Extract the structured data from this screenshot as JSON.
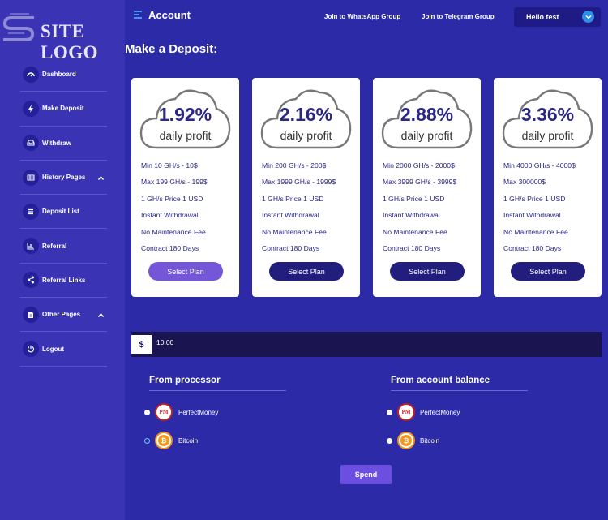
{
  "sidebar": {
    "logo_text": "SITE LOGO",
    "items": [
      {
        "label": "Dashboard",
        "icon": "gauge-icon"
      },
      {
        "label": "Make Deposit",
        "icon": "bolt-icon"
      },
      {
        "label": "Withdraw",
        "icon": "tray-icon"
      },
      {
        "label": "History Pages",
        "icon": "table-icon",
        "caret": "^"
      },
      {
        "label": "Deposit List",
        "icon": "list-icon"
      },
      {
        "label": "Referral",
        "icon": "bar-chart-icon"
      },
      {
        "label": "Referral Links",
        "icon": "share-icon"
      },
      {
        "label": "Other Pages",
        "icon": "file-icon",
        "caret": "^"
      },
      {
        "label": "Logout",
        "icon": "power-icon"
      }
    ]
  },
  "header": {
    "title": "Account",
    "whatsapp_link": "Join to WhatsApp Group",
    "telegram_link": "Join to Telegram Group",
    "user_label": "Hello test"
  },
  "page_title": "Make a Deposit:",
  "plans": [
    {
      "pct": "1.92%",
      "sub": "daily profit",
      "features": [
        "Min 10 GH/s - 10$",
        "Max 199 GH/s - 199$",
        "1 GH/s Price 1 USD",
        "Instant Withdrawal",
        "No Maintenance Fee",
        "Contract 180 Days"
      ],
      "button": "Select Plan"
    },
    {
      "pct": "2.16%",
      "sub": "daily profit",
      "features": [
        "Min 200 GH/s - 200$",
        "Max 1999 GH/s - 1999$",
        "1 GH/s Price 1 USD",
        "Instant Withdrawal",
        "No Maintenance Fee",
        "Contract 180 Days"
      ],
      "button": "Select Plan"
    },
    {
      "pct": "2.88%",
      "sub": "daily profit",
      "features": [
        "Min 2000 GH/s - 2000$",
        "Max 3999 GH/s - 3999$",
        "1 GH/s Price 1 USD",
        "Instant Withdrawal",
        "No Maintenance Fee",
        "Contract 180 Days"
      ],
      "button": "Select Plan"
    },
    {
      "pct": "3.36%",
      "sub": "daily profit",
      "features": [
        "Min 4000 GH/s - 4000$",
        "Max 300000$",
        "1 GH/s Price 1 USD",
        "Instant Withdrawal",
        "No Maintenance Fee",
        "Contract 180 Days"
      ],
      "button": "Select Plan"
    }
  ],
  "amount": {
    "currency": "$",
    "value": "10.00"
  },
  "processor": {
    "heading": "From processor",
    "options": [
      {
        "icon_text": "PM",
        "label": "PerfectMoney"
      },
      {
        "icon_text": "₿",
        "label": "Bitcoin"
      }
    ]
  },
  "balance": {
    "heading": "From account balance",
    "options": [
      {
        "icon_text": "PM",
        "label": "PerfectMoney"
      },
      {
        "icon_text": "₿",
        "label": "Bitcoin"
      }
    ]
  },
  "spend_label": "Spend",
  "colors": {
    "background": "#2c2aa6",
    "sidebar": "#3a33b4",
    "accent": "#7456d9",
    "button_dark": "#221e7e"
  }
}
